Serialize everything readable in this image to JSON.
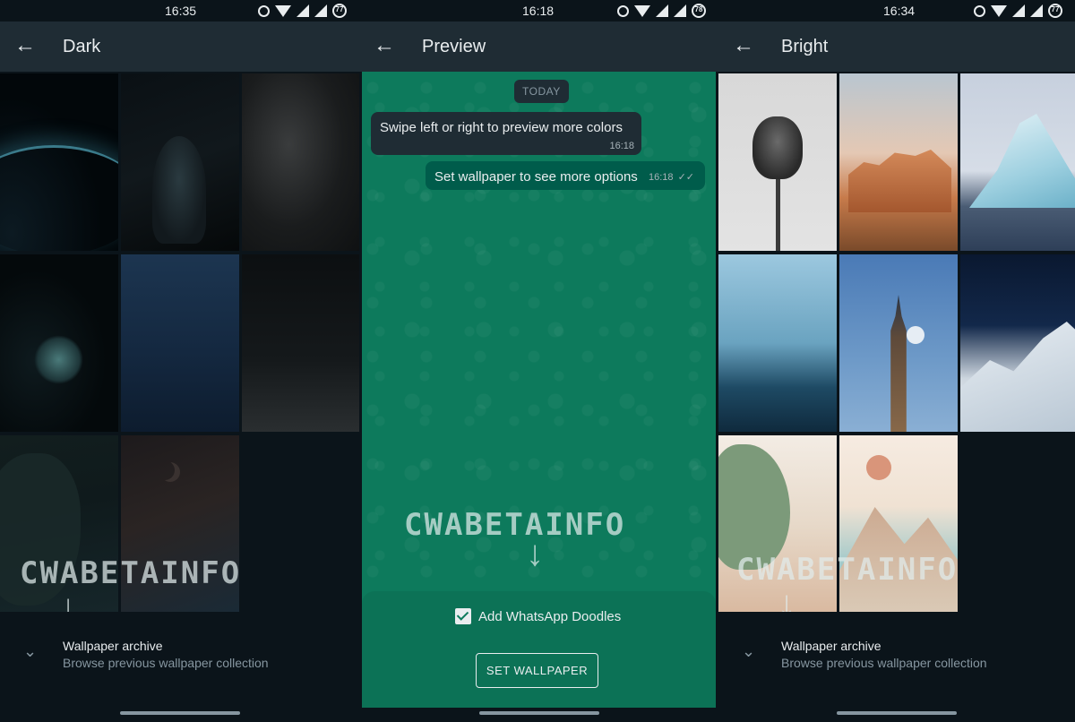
{
  "panels": {
    "dark": {
      "status_time": "16:35",
      "battery": "77",
      "title": "Dark",
      "archive_title": "Wallpaper archive",
      "archive_subtitle": "Browse previous wallpaper collection"
    },
    "preview": {
      "status_time": "16:18",
      "battery": "78",
      "title": "Preview",
      "date_chip": "TODAY",
      "incoming_message": "Swipe left or right to preview more colors",
      "incoming_time": "16:18",
      "outgoing_message": "Set wallpaper to see more options",
      "outgoing_time": "16:18",
      "doodles_label": "Add WhatsApp Doodles",
      "doodles_checked": true,
      "set_button": "SET WALLPAPER"
    },
    "bright": {
      "status_time": "16:34",
      "battery": "77",
      "title": "Bright",
      "archive_title": "Wallpaper archive",
      "archive_subtitle": "Browse previous wallpaper collection"
    }
  },
  "watermark": "CWABETAINFO",
  "icons": {
    "back": "arrow-left-icon",
    "expand": "chevron-down-icon",
    "alarm": "alarm-icon",
    "wifi": "wifi-icon",
    "signal": "signal-icon",
    "battery": "battery-icon",
    "check": "checkbox-checked-icon"
  },
  "colors": {
    "app_bar": "#1f2c34",
    "background": "#0b141a",
    "preview_wallpaper": "#0d7a5c",
    "outgoing_bubble": "#005c4b",
    "incoming_bubble": "#1f2c34"
  }
}
